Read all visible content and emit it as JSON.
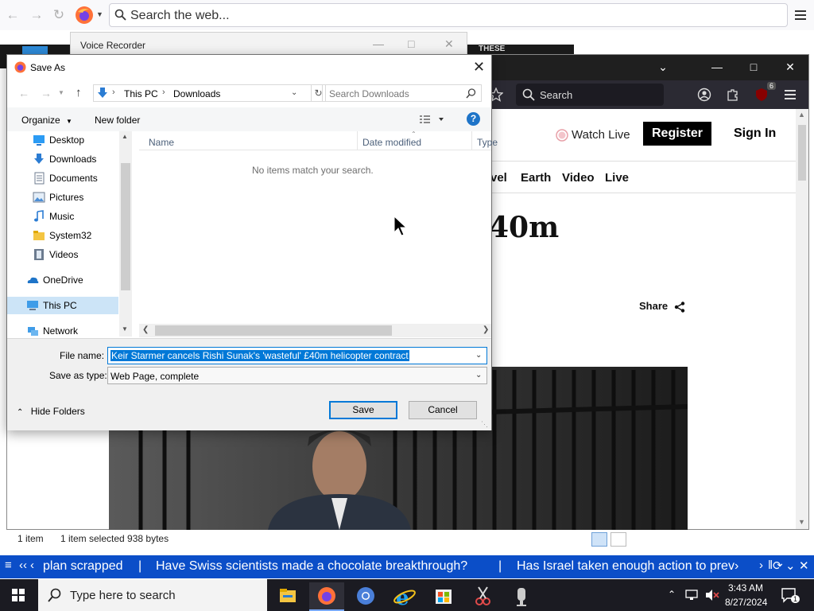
{
  "outer_browser": {
    "search_placeholder": "Search the web...",
    "voice_recorder_title": "Voice Recorder",
    "strip_text": "THESE"
  },
  "inner_browser": {
    "search_label": "Search",
    "extension_badge": "6",
    "header": {
      "watch_live": "Watch Live",
      "register": "Register",
      "sign_in": "Sign In"
    },
    "nav": [
      "vel",
      "Earth",
      "Video",
      "Live"
    ],
    "headline_fragment": "40m",
    "share": "Share"
  },
  "explorer_status": {
    "items": "1 item",
    "selected": "1 item selected  938 bytes"
  },
  "ticker": {
    "items": [
      "plan scrapped",
      "Have Swiss scientists made a chocolate breakthrough?",
      "Has Israel taken enough action to prev›"
    ]
  },
  "taskbar": {
    "search_placeholder": "Type here to search",
    "time": "3:43 AM",
    "date": "8/27/2024",
    "notification_count": "1"
  },
  "dialog": {
    "title": "Save As",
    "breadcrumb": [
      "This PC",
      "Downloads"
    ],
    "search_placeholder": "Search Downloads",
    "organize": "Organize",
    "new_folder": "New folder",
    "nav_items": [
      {
        "label": "Desktop",
        "icon": "desktop-icon",
        "pinned": true
      },
      {
        "label": "Downloads",
        "icon": "downloads-icon",
        "pinned": true
      },
      {
        "label": "Documents",
        "icon": "documents-icon",
        "pinned": true
      },
      {
        "label": "Pictures",
        "icon": "pictures-icon",
        "pinned": true
      },
      {
        "label": "Music",
        "icon": "music-icon",
        "pinned": false
      },
      {
        "label": "System32",
        "icon": "folder-icon",
        "pinned": false
      },
      {
        "label": "Videos",
        "icon": "videos-icon",
        "pinned": false
      },
      {
        "label": "OneDrive",
        "icon": "onedrive-icon",
        "pinned": false
      },
      {
        "label": "This PC",
        "icon": "this-pc-icon",
        "pinned": false
      },
      {
        "label": "Network",
        "icon": "network-icon",
        "pinned": false
      }
    ],
    "columns": [
      "Name",
      "Date modified",
      "Type"
    ],
    "empty_message": "No items match your search.",
    "file_name_label": "File name:",
    "file_name_value": "Keir Starmer cancels Rishi Sunak's 'wasteful' £40m helicopter contract",
    "save_type_label": "Save as type:",
    "save_type_value": "Web Page, complete",
    "hide_folders": "Hide Folders",
    "save_button": "Save",
    "cancel_button": "Cancel"
  }
}
